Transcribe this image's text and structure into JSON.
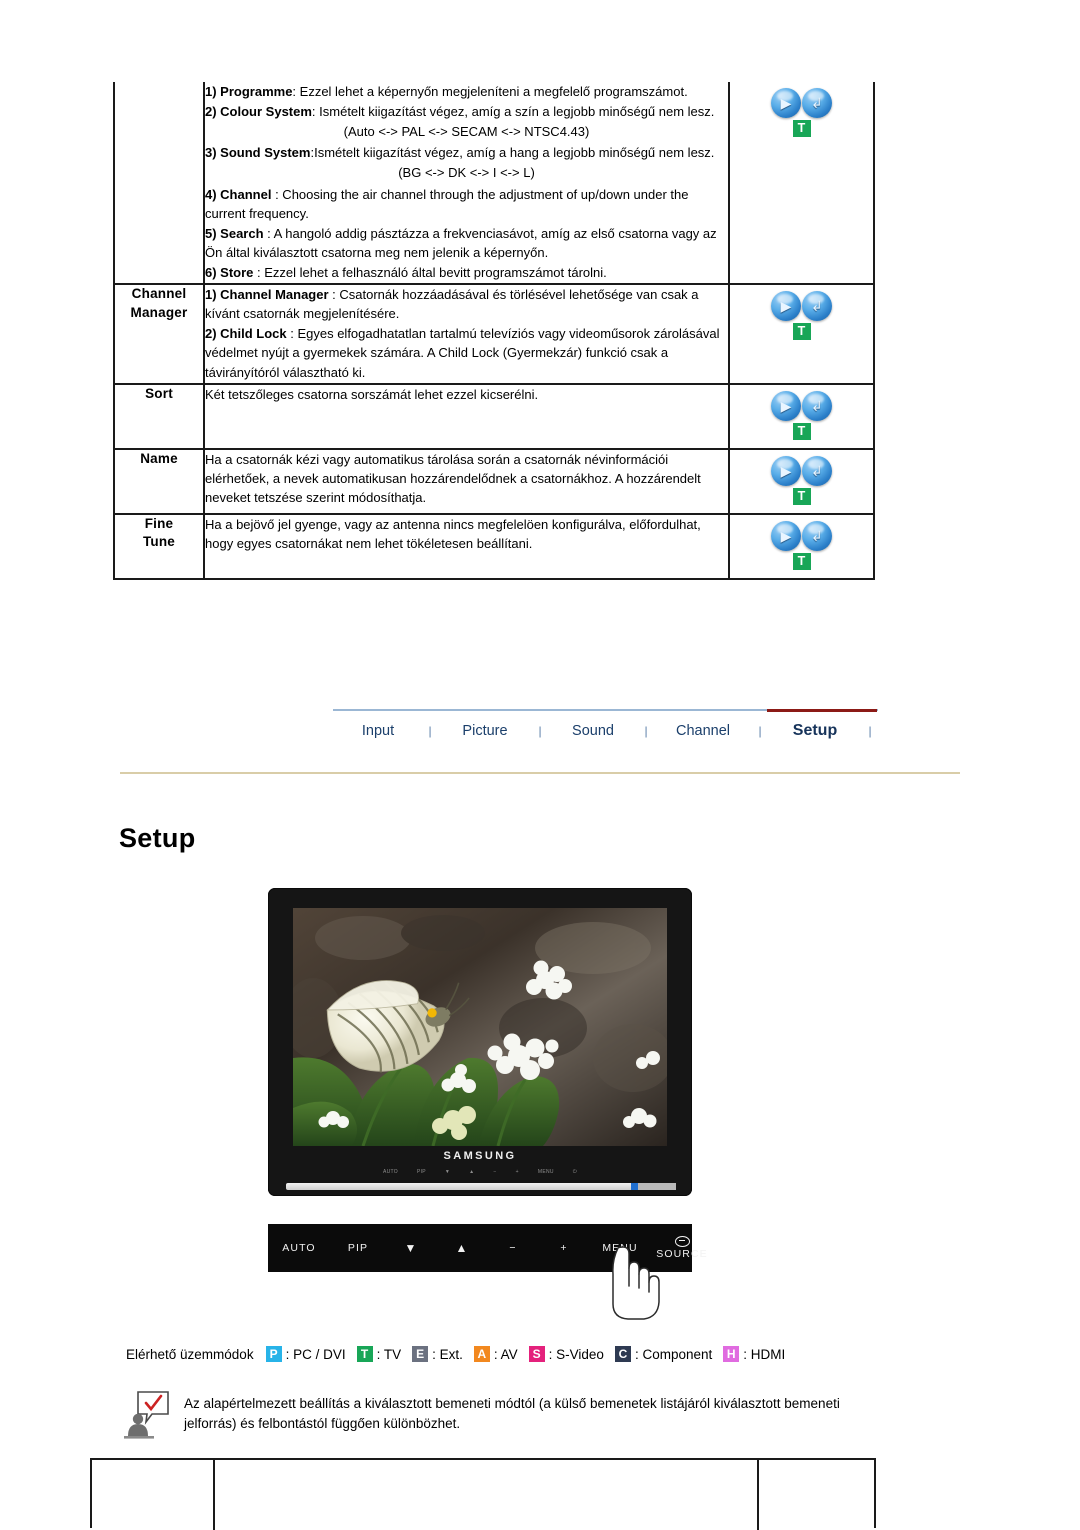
{
  "spec_table": {
    "rows": [
      {
        "label": "",
        "icons": {
          "play": "play-icon",
          "enter": "enter-icon",
          "badge": "T"
        },
        "paragraphs": [
          {
            "bold": "1) Programme",
            "rest": ": Ezzel lehet a képernyőn megjeleníteni a megfelelő programszámot."
          },
          {
            "bold": "2) Colour System",
            "rest": ": Ismételt kiigazítást végez, amíg a szín a legjobb minőségű nem lesz."
          },
          {
            "center": "(Auto <-> PAL <-> SECAM <-> NTSC4.43)"
          },
          {
            "bold": "3) Sound System",
            "rest": ":Ismételt kiigazítást végez, amíg a hang a legjobb minőségű nem lesz."
          },
          {
            "center": "(BG <-> DK <-> I <-> L)"
          },
          {
            "bold": "4) Channel",
            "rest": " : Choosing the air channel through the adjustment of up/down under the current frequency."
          },
          {
            "bold": "5) Search",
            "rest": " : A hangoló addig pásztázza a frekvenciasávot, amíg az első csatorna vagy az Ön által kiválasztott csatorna meg nem jelenik a képernyőn."
          },
          {
            "bold": "6) Store",
            "rest": " : Ezzel lehet a felhasználó által bevitt programszámot tárolni."
          }
        ]
      },
      {
        "label": "Channel\nManager",
        "icons": {
          "play": "play-icon",
          "enter": "enter-icon",
          "badge": "T"
        },
        "paragraphs": [
          {
            "bold": "1) Channel Manager",
            "rest": " : Csatornák hozzáadásával és törlésével lehetősége van csak a kívánt csatornák megjelenítésére."
          },
          {
            "bold": "2) Child Lock",
            "rest": " : Egyes elfogadhatatlan tartalmú televíziós vagy videoműsorok zárolásával védelmet nyújt a gyermekek számára. A Child Lock (Gyermekzár) funkció csak a távirányítóról választható ki."
          }
        ]
      },
      {
        "label": "Sort",
        "icons": {
          "play": "play-icon",
          "enter": "enter-icon",
          "badge": "T"
        },
        "paragraphs": [
          {
            "bold": "",
            "rest": "Két tetszőleges csatorna sorszámát lehet ezzel kicserélni."
          }
        ]
      },
      {
        "label": "Name",
        "icons": {
          "play": "play-icon",
          "enter": "enter-icon",
          "badge": "T"
        },
        "paragraphs": [
          {
            "bold": "",
            "rest": "Ha a csatornák kézi vagy automatikus tárolása során a csatornák névinformációi elérhetőek, a nevek automatikusan hozzárendelődnek a csatornákhoz. A hozzárendelt neveket tetszése szerint módosíthatja."
          }
        ]
      },
      {
        "label": "Fine\nTune",
        "icons": {
          "play": "play-icon",
          "enter": "enter-icon",
          "badge": "T"
        },
        "paragraphs": [
          {
            "bold": "",
            "rest": "Ha a bejövő jel gyenge, vagy az antenna nincs megfelelöen konfigurálva, előfordulhat, hogy egyes csatornákat nem lehet tökéletesen beállítani."
          }
        ]
      }
    ]
  },
  "nav": {
    "items": [
      "Input",
      "Picture",
      "Sound",
      "Channel",
      "Setup"
    ],
    "active": "Setup",
    "separator": "|",
    "active_underline_color": "#8c1a16",
    "line_color": "#9bb7d4",
    "text_color": "#1b3f6b"
  },
  "page": {
    "title": "Setup",
    "rule_color": "#d9cda8"
  },
  "monitor": {
    "brand": "SAMSUNG",
    "micro_labels": [
      "AUTO",
      "PIP",
      "▼",
      "▲",
      "−",
      "+",
      "MENU",
      "⏻"
    ],
    "buttons": [
      {
        "label": "AUTO",
        "name": "auto-button"
      },
      {
        "label": "PIP",
        "name": "pip-button"
      },
      {
        "label": "▼",
        "name": "down-button"
      },
      {
        "label": "▲",
        "name": "up-button"
      },
      {
        "label": "−",
        "name": "minus-button"
      },
      {
        "label": "+",
        "name": "plus-button"
      },
      {
        "label": "MENU",
        "name": "menu-button"
      },
      {
        "label": "SOURCE",
        "name": "source-button"
      }
    ]
  },
  "legend": {
    "lead": "Elérhető üzemmódok",
    "items": [
      {
        "code": "P",
        "text": ": PC / DVI",
        "color": "#27b3e8"
      },
      {
        "code": "T",
        "text": ": TV",
        "color": "#18a657"
      },
      {
        "code": "E",
        "text": ": Ext.",
        "color": "#6b7180"
      },
      {
        "code": "A",
        "text": ": AV",
        "color": "#f2881f"
      },
      {
        "code": "S",
        "text": ": S-Video",
        "color": "#e4217c"
      },
      {
        "code": "C",
        "text": ": Component",
        "color": "#2e3a52"
      },
      {
        "code": "H",
        "text": ": HDMI",
        "color": "#e06be0"
      }
    ]
  },
  "note": {
    "icon": "person-with-check-bubble-icon",
    "check_color": "#cc2222",
    "text": "Az alapértelmezett beállítás a kiválasztott bemeneti módtól (a külső bemenetek listájáról kiválasztott bemeneti jelforrás) és felbontástól függően különbözhet."
  }
}
